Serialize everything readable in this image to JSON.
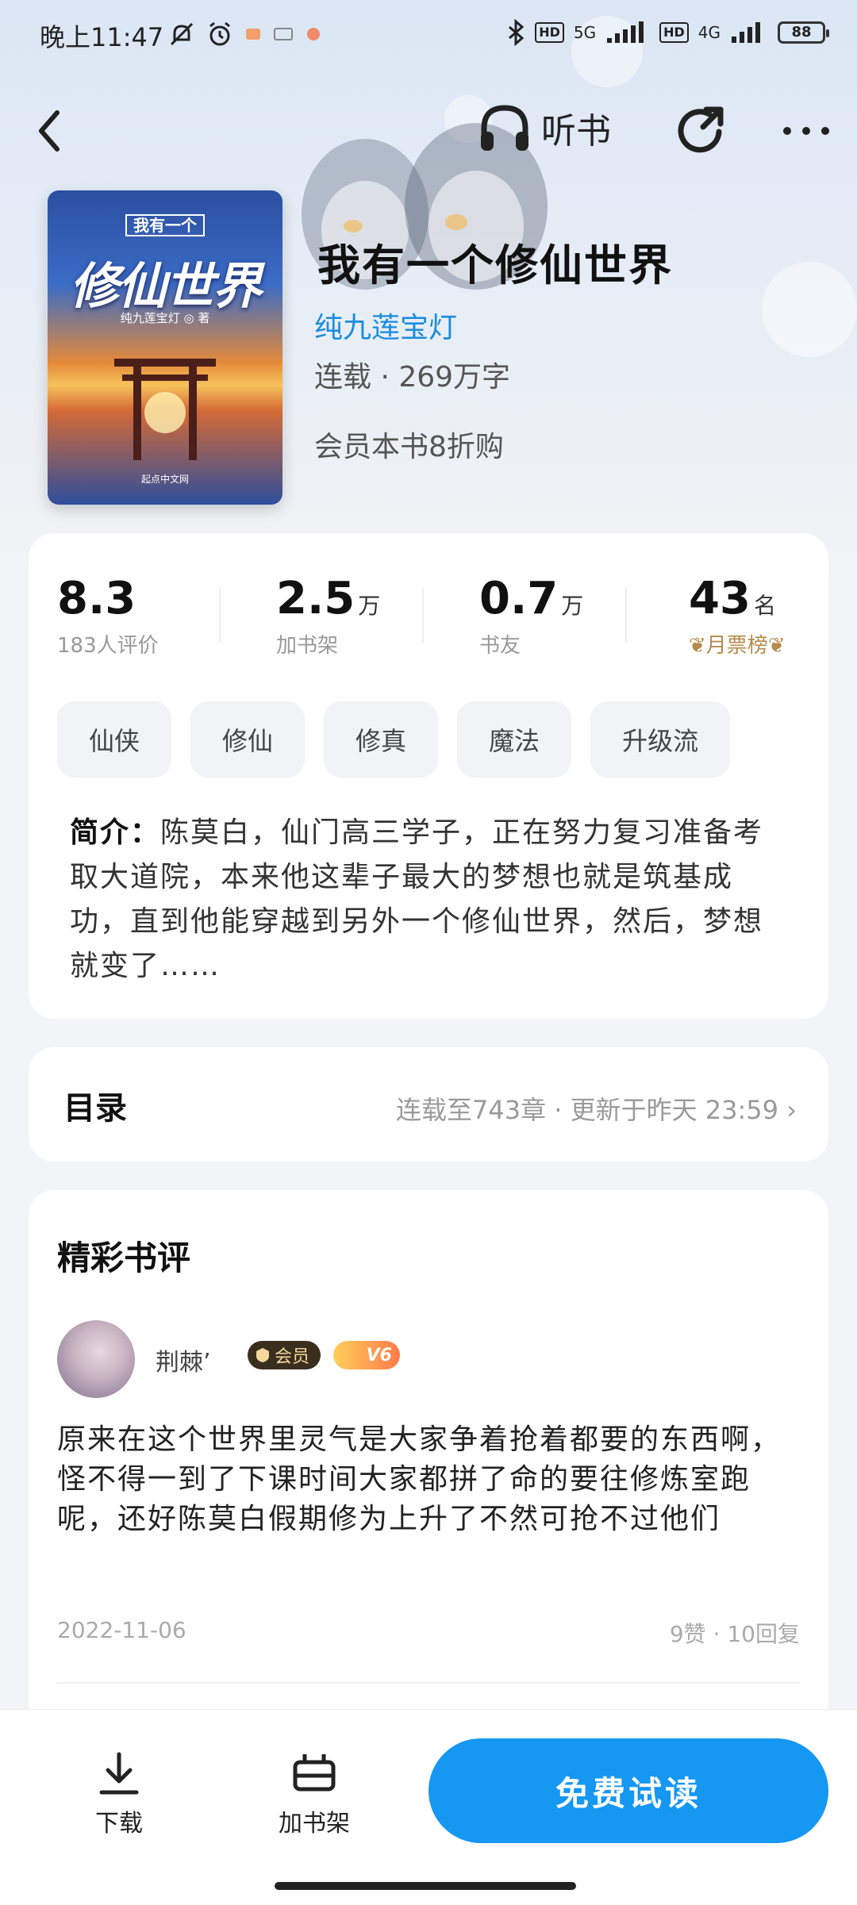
{
  "status_bar": {
    "time": "晚上11:47",
    "battery": "88",
    "network_5g": "5G",
    "network_4g": "4G",
    "hd": "HD"
  },
  "top_bar": {
    "listen_label": "听书"
  },
  "cover": {
    "top_label": "我有一个",
    "title": "修仙世界",
    "author_line": "纯九莲宝灯 ◎ 著",
    "publisher": "起点中文网"
  },
  "book": {
    "title": "我有一个修仙世界",
    "author": "纯九莲宝灯",
    "meta": "连载 · 269万字",
    "promo": "会员本书8折购"
  },
  "stats": [
    {
      "value": "8.3",
      "unit": "",
      "label": "183人评价"
    },
    {
      "value": "2.5",
      "unit": "万",
      "label": "加书架"
    },
    {
      "value": "0.7",
      "unit": "万",
      "label": "书友"
    },
    {
      "value": "43",
      "unit": "名",
      "label": "月票榜"
    }
  ],
  "tags": [
    "仙侠",
    "修仙",
    "修真",
    "魔法",
    "升级流"
  ],
  "intro": {
    "label": "简介：",
    "text": "陈莫白，仙门高三学子，正在努力复习准备考取大道院，本来他这辈子最大的梦想也就是筑基成功，直到他能穿越到另外一个修仙世界，然后，梦想就变了……"
  },
  "toc": {
    "title": "目录",
    "status": "连载至743章 · 更新于昨天  23:59 ›"
  },
  "reviews": {
    "heading": "精彩书评",
    "items": [
      {
        "user": "荆棘’",
        "vip_label": "会员",
        "level": "V6",
        "text": "原来在这个世界里灵气是大家争着抢着都要的东西啊，怪不得一到了下课时间大家都拼了命的要往修炼室跑呢，还好陈莫白假期修为上升了不然可抢不过他们",
        "date": "2022-11-06",
        "stats": "9赞 · 10回复"
      }
    ]
  },
  "bottom_bar": {
    "download_label": "下载",
    "shelf_label": "加书架",
    "read_label": "免费试读"
  },
  "colors": {
    "accent": "#1597f2",
    "author_link": "#1a8cde",
    "rank_gold": "#b58a4a"
  }
}
